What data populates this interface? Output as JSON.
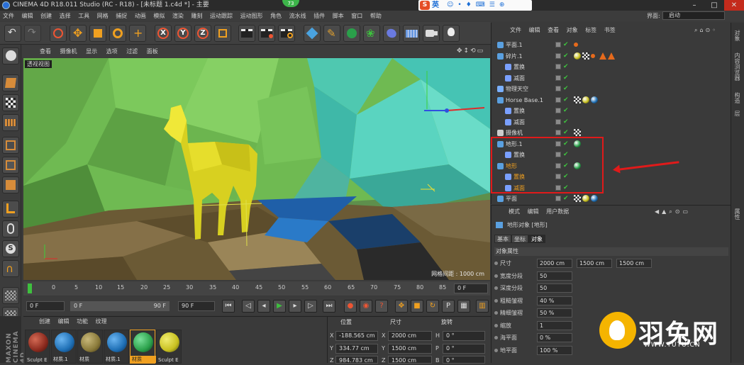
{
  "window": {
    "title": "CINEMA 4D R18.011 Studio (RC - R18) - [未标题 1.c4d *] - 主要",
    "badge": "73",
    "ime_label": "英",
    "ime_logo": "S"
  },
  "menubar": {
    "items": [
      "文件",
      "编辑",
      "创建",
      "选择",
      "工具",
      "网格",
      "捕捉",
      "动画",
      "模拟",
      "渲染",
      "雕刻",
      "运动跟踪",
      "运动图形",
      "角色",
      "流水线",
      "插件",
      "脚本",
      "窗口",
      "帮助"
    ],
    "layout_label": "界面:",
    "layout_value": "启动"
  },
  "viewport": {
    "menu": [
      "查看",
      "摄像机",
      "显示",
      "选项",
      "过滤",
      "面板"
    ],
    "label": "透视视图",
    "grid_info": "网格间距 : 1000 cm"
  },
  "timeline": {
    "ticks": [
      "0",
      "5",
      "10",
      "15",
      "20",
      "25",
      "30",
      "35",
      "40",
      "45",
      "50",
      "55",
      "60",
      "65",
      "70",
      "75",
      "80",
      "85",
      "90"
    ],
    "current_frame": "0 F"
  },
  "playback": {
    "start": "0 F",
    "range_start": "0 F",
    "range_end": "90 F",
    "end": "90 F"
  },
  "materials": {
    "menu": [
      "创建",
      "编辑",
      "功能",
      "纹理"
    ],
    "items": [
      {
        "label": "Sculpt E",
        "color": "#8b2a1e"
      },
      {
        "label": "材质.1",
        "color": "#1e6fb5"
      },
      {
        "label": "材质",
        "color": "#8a7a3a"
      },
      {
        "label": "材质.1",
        "color": "#1e6fb5"
      },
      {
        "label": "材质",
        "color": "#2aa04a"
      },
      {
        "label": "Sculpt E",
        "color": "#c8c020"
      }
    ]
  },
  "coords": {
    "headers": [
      "位置",
      "尺寸",
      "旋转"
    ],
    "rows": [
      {
        "axis": "X",
        "pos": "-188.565 cm",
        "size_axis": "X",
        "size": "2000 cm",
        "rot_axis": "H",
        "rot": "0 °"
      },
      {
        "axis": "Y",
        "pos": "334.77 cm",
        "size_axis": "Y",
        "size": "1500 cm",
        "rot_axis": "P",
        "rot": "0 °"
      },
      {
        "axis": "Z",
        "pos": "984.783 cm",
        "size_axis": "Z",
        "size": "1500 cm",
        "rot_axis": "B",
        "rot": "0 °"
      }
    ]
  },
  "object_manager": {
    "menu": [
      "文件",
      "编辑",
      "查看",
      "对象",
      "标签",
      "书签"
    ],
    "objects": [
      {
        "name": "平面.1",
        "indent": 0,
        "icon": "#5aa0e0"
      },
      {
        "name": "碎片.1",
        "indent": 0,
        "icon": "#5aa0e0"
      },
      {
        "name": "置换",
        "indent": 1,
        "icon": "#7aa0ff"
      },
      {
        "name": "减面",
        "indent": 1,
        "icon": "#7aa0ff"
      },
      {
        "name": "物理天空",
        "indent": 0,
        "icon": "#7ab0ff"
      },
      {
        "name": "Horse Base.1",
        "indent": 0,
        "icon": "#5aa0e0"
      },
      {
        "name": "置换",
        "indent": 1,
        "icon": "#7aa0ff"
      },
      {
        "name": "减面",
        "indent": 1,
        "icon": "#7aa0ff"
      },
      {
        "name": "摄像机",
        "indent": 0,
        "icon": "#cccccc"
      },
      {
        "name": "地形.1",
        "indent": 0,
        "icon": "#5aa0e0"
      },
      {
        "name": "置换",
        "indent": 1,
        "icon": "#7aa0ff"
      },
      {
        "name": "地形",
        "indent": 0,
        "icon": "#5aa0e0",
        "highlight": true
      },
      {
        "name": "置换",
        "indent": 1,
        "icon": "#7aa0ff",
        "highlight": true
      },
      {
        "name": "减面",
        "indent": 1,
        "icon": "#7aa0ff",
        "highlight": true
      },
      {
        "name": "平面",
        "indent": 0,
        "icon": "#5aa0e0"
      }
    ]
  },
  "attributes": {
    "menu": [
      "模式",
      "编辑",
      "用户数据"
    ],
    "header": "地形对象 [地形]",
    "tabs": [
      "基本",
      "坐标",
      "对象"
    ],
    "section": "对象属性",
    "rows": [
      {
        "label": "尺寸",
        "values": [
          "2000 cm",
          "1500 cm",
          "1500 cm"
        ]
      },
      {
        "label": "宽度分段",
        "values": [
          "50"
        ]
      },
      {
        "label": "深度分段",
        "values": [
          "50"
        ]
      },
      {
        "label": "粗糙皱褶",
        "values": [
          "40 %"
        ]
      },
      {
        "label": "精细皱褶",
        "values": [
          "50 %"
        ]
      },
      {
        "label": "缩放",
        "values": [
          "1"
        ]
      },
      {
        "label": "海平面",
        "values": [
          "0 %"
        ]
      },
      {
        "label": "地平面",
        "values": [
          "100 %"
        ]
      }
    ]
  },
  "right_strip": {
    "labels": [
      "对象",
      "内容浏览器",
      "构造",
      "层",
      "属性"
    ]
  },
  "left_vertical": "MAXON CINEMA 4D",
  "watermark": {
    "text": "羽兔网",
    "url": "WWW.YUTU.CN"
  }
}
